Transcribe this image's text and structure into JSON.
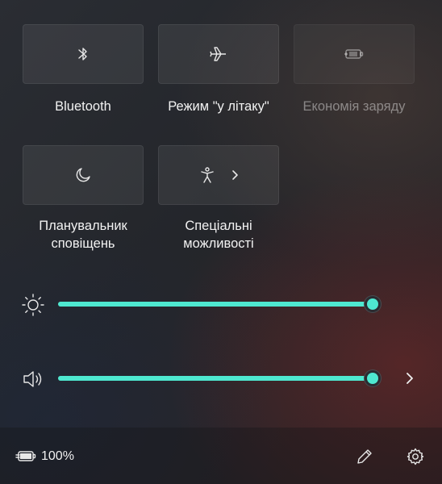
{
  "quick_settings": {
    "tiles": [
      {
        "label": "Bluetooth",
        "icon": "bluetooth-icon",
        "state": "off"
      },
      {
        "label": "Режим \"у літаку\"",
        "icon": "airplane-icon",
        "state": "off"
      },
      {
        "label": "Економія заряду",
        "icon": "battery-saver-icon",
        "state": "disabled"
      },
      {
        "label": "Планувальник\nсповіщень",
        "icon": "moon-icon",
        "state": "off"
      },
      {
        "label": "Спеціальні\nможливості",
        "icon": "accessibility-icon",
        "has_chevron": true
      }
    ],
    "brightness": {
      "icon": "sun-icon",
      "value_percent": 100
    },
    "volume": {
      "icon": "speaker-icon",
      "value_percent": 100,
      "chevron": "chevron-right-icon"
    },
    "accent_color": "#4ee8d0"
  },
  "footer": {
    "battery": {
      "icon": "battery-charging-icon",
      "percent": "100%"
    },
    "edit_icon": "pencil-icon",
    "settings_icon": "gear-icon"
  }
}
